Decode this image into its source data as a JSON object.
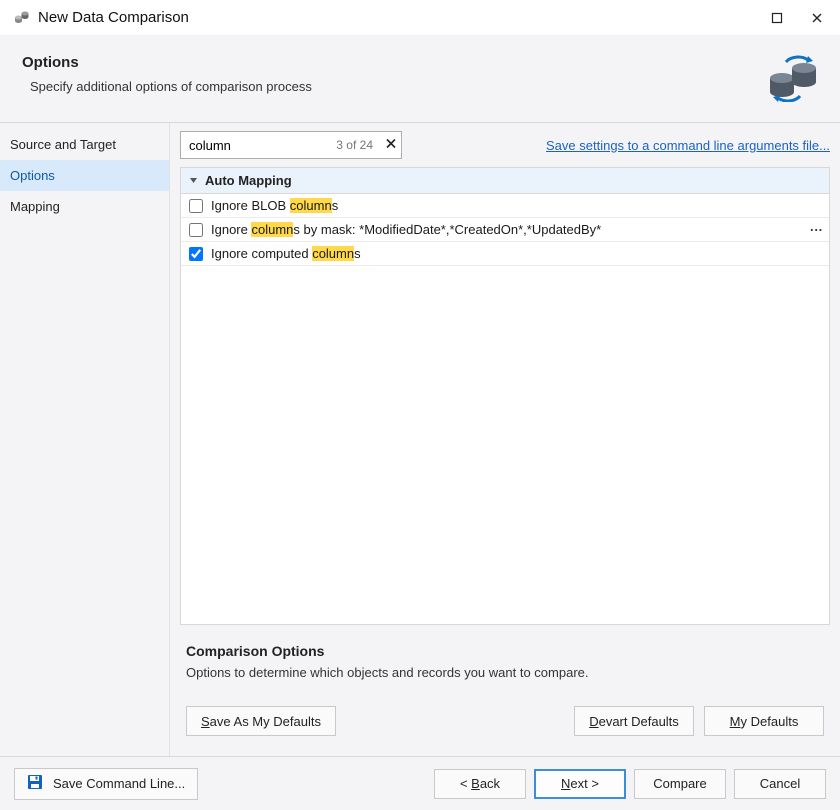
{
  "window": {
    "title": "New Data Comparison"
  },
  "header": {
    "heading": "Options",
    "subtitle": "Specify additional options of comparison process"
  },
  "sidebar": {
    "items": [
      {
        "label": "Source and Target",
        "selected": false
      },
      {
        "label": "Options",
        "selected": true
      },
      {
        "label": "Mapping",
        "selected": false
      }
    ]
  },
  "search": {
    "value": "column",
    "count_text": "3 of 24"
  },
  "save_link": "Save settings to a command line arguments file...",
  "group": {
    "title": "Auto Mapping"
  },
  "options": [
    {
      "label_pre": "Ignore BLOB ",
      "hl": "column",
      "label_post": "s",
      "checked": false,
      "has_mask": false
    },
    {
      "label_pre": "Ignore ",
      "hl": "column",
      "label_post": "s by mask: *ModifiedDate*,*CreatedOn*,*UpdatedBy*",
      "checked": false,
      "has_mask": true
    },
    {
      "label_pre": "Ignore computed ",
      "hl": "column",
      "label_post": "s",
      "checked": true,
      "has_mask": false
    }
  ],
  "description": {
    "title": "Comparison Options",
    "text": "Options to determine which objects and records you want to compare."
  },
  "buttons": {
    "save_defaults": "Save As My Defaults",
    "devart_defaults": "Devart Defaults",
    "my_defaults": "My Defaults",
    "save_cmd": "Save Command Line...",
    "back": "< Back",
    "next": "Next >",
    "compare": "Compare",
    "cancel": "Cancel"
  }
}
